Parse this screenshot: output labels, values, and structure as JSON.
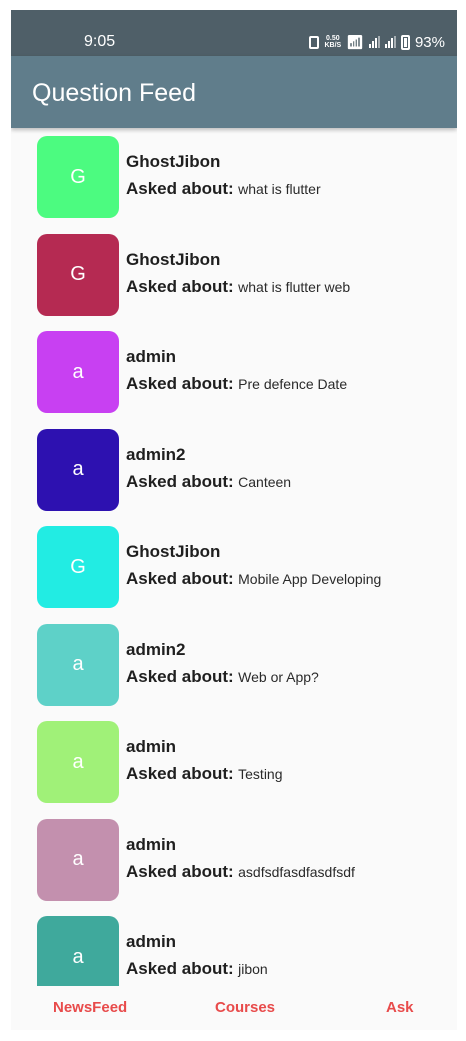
{
  "status": {
    "time": "9:05",
    "netspeed_value": "0.50",
    "netspeed_unit": "KB/S",
    "battery": "93%"
  },
  "appbar": {
    "title": "Question Feed"
  },
  "feed": {
    "asked_label": "Asked about:",
    "items": [
      {
        "initial": "G",
        "user": "GhostJibon",
        "question": "what is flutter",
        "color": "#4cfb80"
      },
      {
        "initial": "G",
        "user": "GhostJibon",
        "question": "what is flutter web",
        "color": "#b52a52"
      },
      {
        "initial": "a",
        "user": "admin",
        "question": "Pre defence Date",
        "color": "#c840f2"
      },
      {
        "initial": "a",
        "user": "admin2",
        "question": "Canteen",
        "color": "#2d11b0"
      },
      {
        "initial": "G",
        "user": "GhostJibon",
        "question": "Mobile App Developing",
        "color": "#22ece3"
      },
      {
        "initial": "a",
        "user": "admin2",
        "question": "Web or App?",
        "color": "#5ed1c8"
      },
      {
        "initial": "a",
        "user": "admin",
        "question": "Testing",
        "color": "#a0f178"
      },
      {
        "initial": "a",
        "user": "admin",
        "question": "asdfsdfasdfasdfsdf",
        "color": "#c390ae"
      },
      {
        "initial": "a",
        "user": "admin",
        "question": "jibon",
        "color": "#3fa99c"
      }
    ]
  },
  "bottom_nav": {
    "newsfeed": "NewsFeed",
    "courses": "Courses",
    "ask": "Ask",
    "color": "#e84b4b"
  }
}
